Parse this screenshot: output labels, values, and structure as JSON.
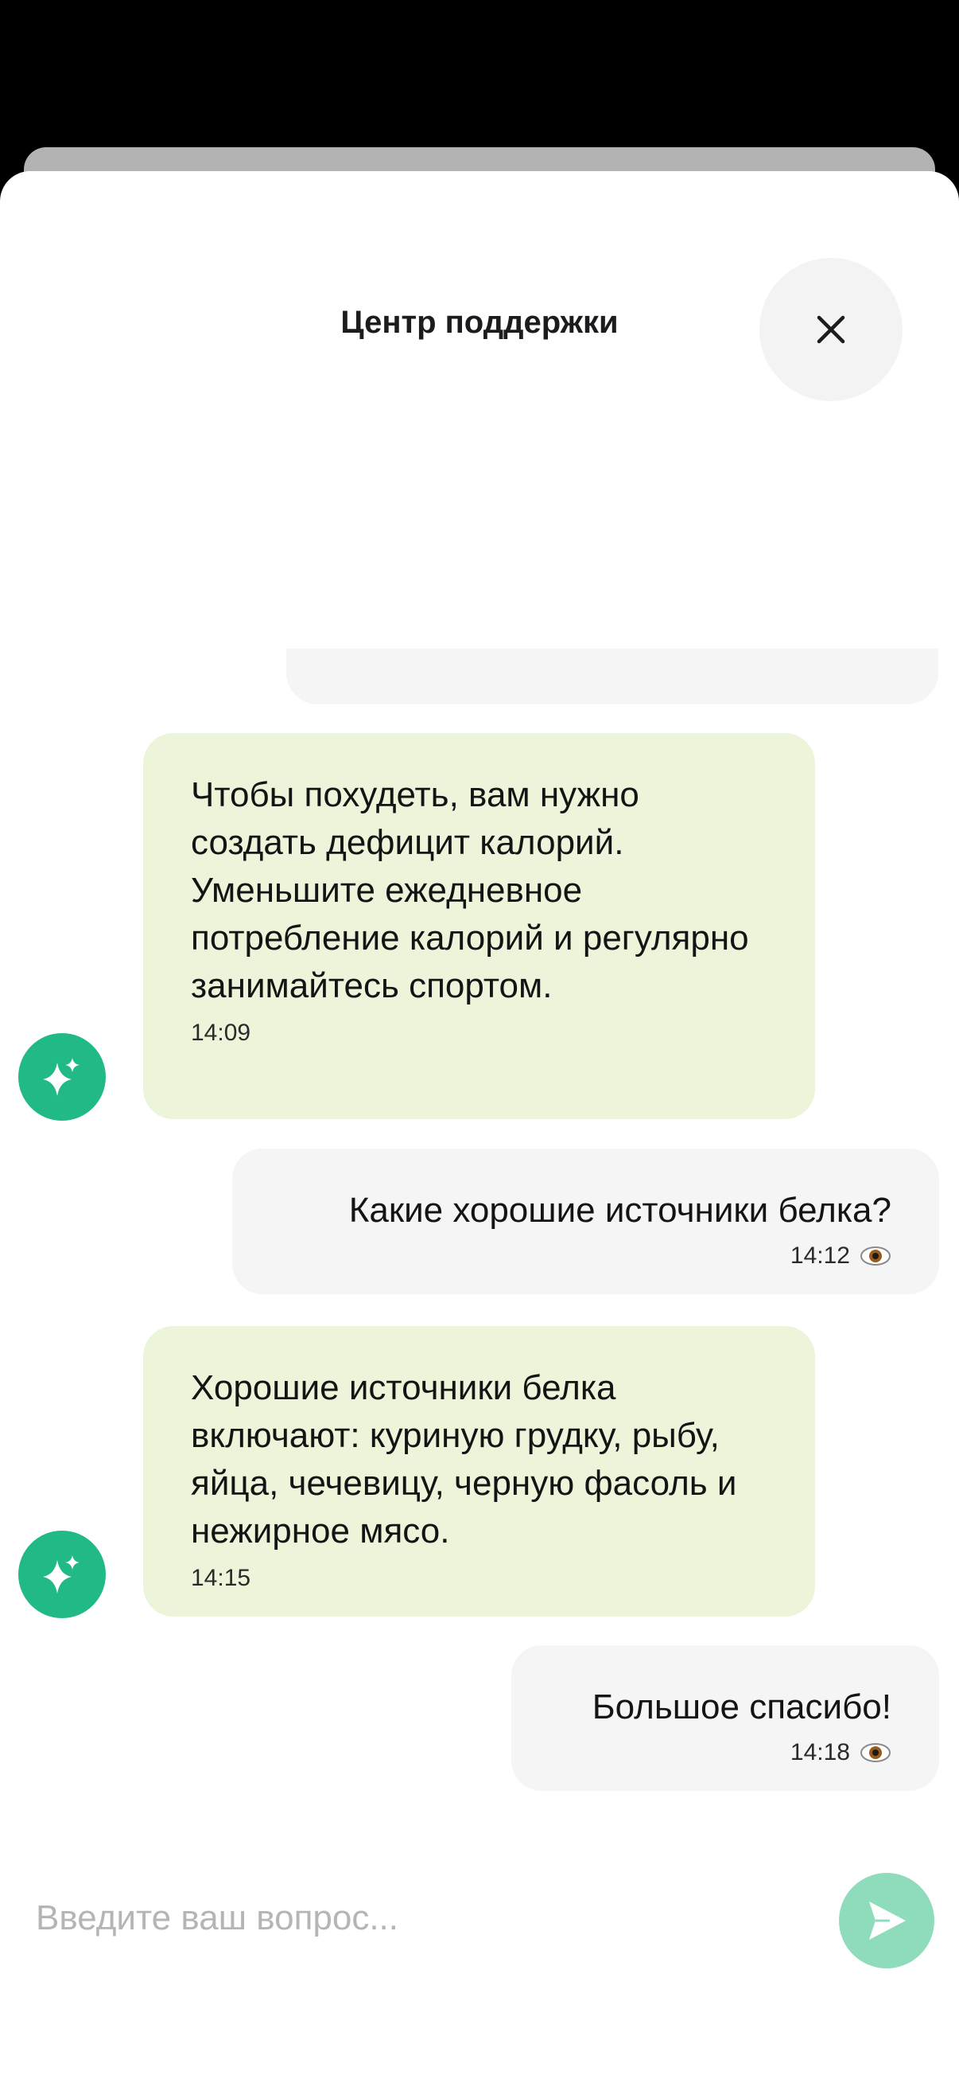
{
  "header": {
    "title": "Центр поддержки",
    "close_icon": "close-icon"
  },
  "messages": [
    {
      "sender": "bot",
      "text": "Чтобы похудеть, вам нужно создать дефицит калорий. Уменьшите ежедневное потребление калорий и регулярно занимайтесь спортом.",
      "time": "14:09",
      "avatar_icon": "sparkles-icon"
    },
    {
      "sender": "user",
      "text": "Какие хорошие источники белка?",
      "time": "14:12",
      "status_icon": "eye-icon"
    },
    {
      "sender": "bot",
      "text": "Хорошие источники белка включают: куриную грудку, рыбу, яйца, чечевицу, черную фасоль и нежирное мясо.",
      "time": "14:15",
      "avatar_icon": "sparkles-icon"
    },
    {
      "sender": "user",
      "text": "Большое спасибо!",
      "time": "14:18",
      "status_icon": "eye-icon"
    }
  ],
  "input": {
    "placeholder": "Введите ваш вопрос...",
    "value": "",
    "send_icon": "send-icon"
  },
  "colors": {
    "accent": "#21ba86",
    "send_button": "#8fdcbd",
    "bot_bubble": "#ecf5da",
    "user_bubble": "#f4f5f4"
  }
}
